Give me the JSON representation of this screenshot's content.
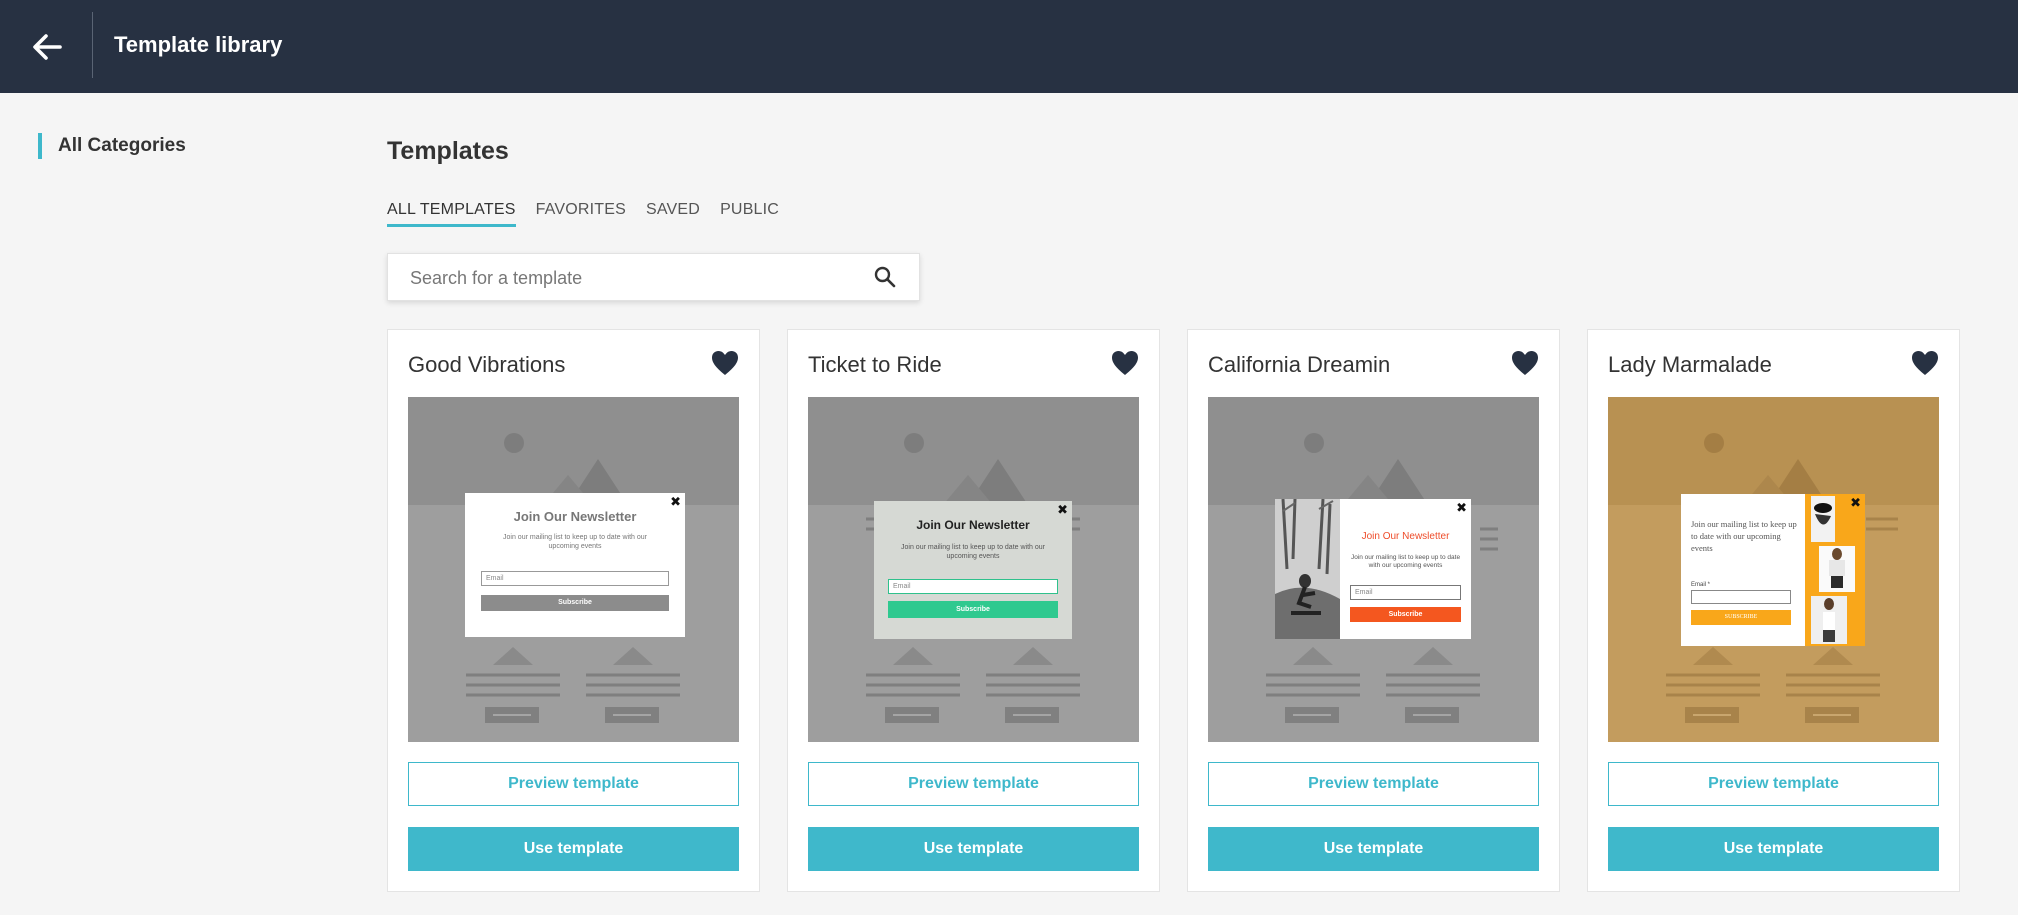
{
  "header": {
    "back_icon": "arrow-left-icon",
    "title": "Template library"
  },
  "sidebar": {
    "items": [
      {
        "label": "All Categories",
        "active": true
      }
    ]
  },
  "main": {
    "title": "Templates",
    "tabs": [
      {
        "label": "ALL TEMPLATES",
        "active": true
      },
      {
        "label": "FAVORITES"
      },
      {
        "label": "SAVED"
      },
      {
        "label": "PUBLIC"
      }
    ],
    "search": {
      "placeholder": "Search for a template",
      "value": "",
      "icon": "search-icon"
    }
  },
  "colors": {
    "header_bg": "#273142",
    "accent": "#3eb8cb",
    "heart": "#273142"
  },
  "cards": [
    {
      "title": "Good Vibrations",
      "favorite_icon": "heart-icon",
      "preview_label": "Preview template",
      "use_label": "Use template",
      "popup": {
        "heading": "Join Our Newsletter",
        "text": "Join our mailing list to keep up to date with our upcoming events",
        "email_placeholder": "Email",
        "button": "Subscribe"
      }
    },
    {
      "title": "Ticket to Ride",
      "favorite_icon": "heart-icon",
      "preview_label": "Preview template",
      "use_label": "Use template",
      "popup": {
        "heading": "Join Our Newsletter",
        "text": "Join our mailing list to keep up to date with our upcoming events",
        "email_placeholder": "Email",
        "button": "Subscribe"
      }
    },
    {
      "title": "California Dreamin",
      "favorite_icon": "heart-icon",
      "preview_label": "Preview template",
      "use_label": "Use template",
      "popup": {
        "heading": "Join Our Newsletter",
        "text": "Join our mailing list to keep up to date with our upcoming events",
        "email_placeholder": "Email",
        "button": "Subscribe"
      }
    },
    {
      "title": "Lady Marmalade",
      "favorite_icon": "heart-icon",
      "preview_label": "Preview template",
      "use_label": "Use template",
      "popup": {
        "text": "Join our mailing list to keep up to date with our upcoming events",
        "email_label": "Email *",
        "button": "SUBSCRIBE"
      }
    }
  ]
}
